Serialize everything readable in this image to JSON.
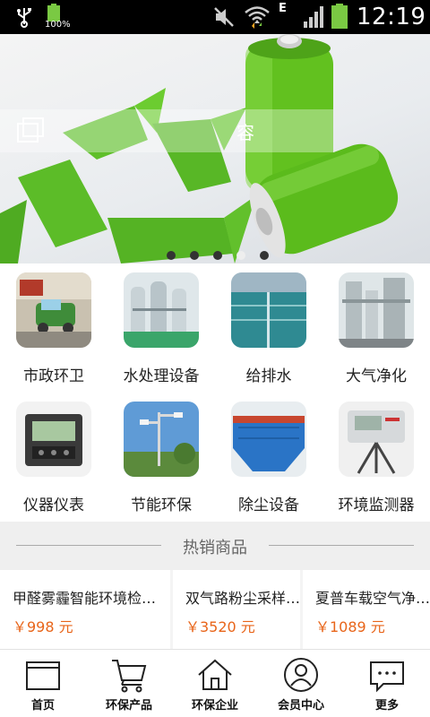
{
  "status_bar": {
    "battery_small_label": "100%",
    "network_type": "E",
    "time": "12:19",
    "icons": [
      "usb-icon",
      "battery-icon",
      "mute-icon",
      "wifi-icon",
      "signal-icon",
      "battery-icon"
    ]
  },
  "banner": {
    "caption": "容",
    "slide_count": 5,
    "active_slide": 4
  },
  "categories": [
    {
      "label": "市政环卫",
      "icon": "street-sweeper-image"
    },
    {
      "label": "水处理设备",
      "icon": "water-treatment-image"
    },
    {
      "label": "给排水",
      "icon": "water-drainage-image"
    },
    {
      "label": "大气净化",
      "icon": "air-purification-image"
    },
    {
      "label": "仪器仪表",
      "icon": "instrument-meter-image"
    },
    {
      "label": "节能环保",
      "icon": "street-light-image"
    },
    {
      "label": "除尘设备",
      "icon": "dust-collector-image"
    },
    {
      "label": "环境监测器",
      "icon": "environment-monitor-image"
    }
  ],
  "hot_section": {
    "title": "热销商品",
    "products": [
      {
        "name": "甲醛雾霾智能环境检…",
        "price": "￥998 元"
      },
      {
        "name": "双气路粉尘采样…",
        "price": "￥3520 元"
      },
      {
        "name": "夏普车载空气净…",
        "price": "￥1089 元"
      }
    ]
  },
  "tabbar": [
    {
      "label": "首页",
      "icon": "home-monitor-icon"
    },
    {
      "label": "环保产品",
      "icon": "cart-icon"
    },
    {
      "label": "环保企业",
      "icon": "house-icon"
    },
    {
      "label": "会员中心",
      "icon": "user-icon"
    },
    {
      "label": "更多",
      "icon": "more-chat-icon"
    }
  ],
  "colors": {
    "accent_price": "#e8651a",
    "battery_green": "#7ac943"
  }
}
